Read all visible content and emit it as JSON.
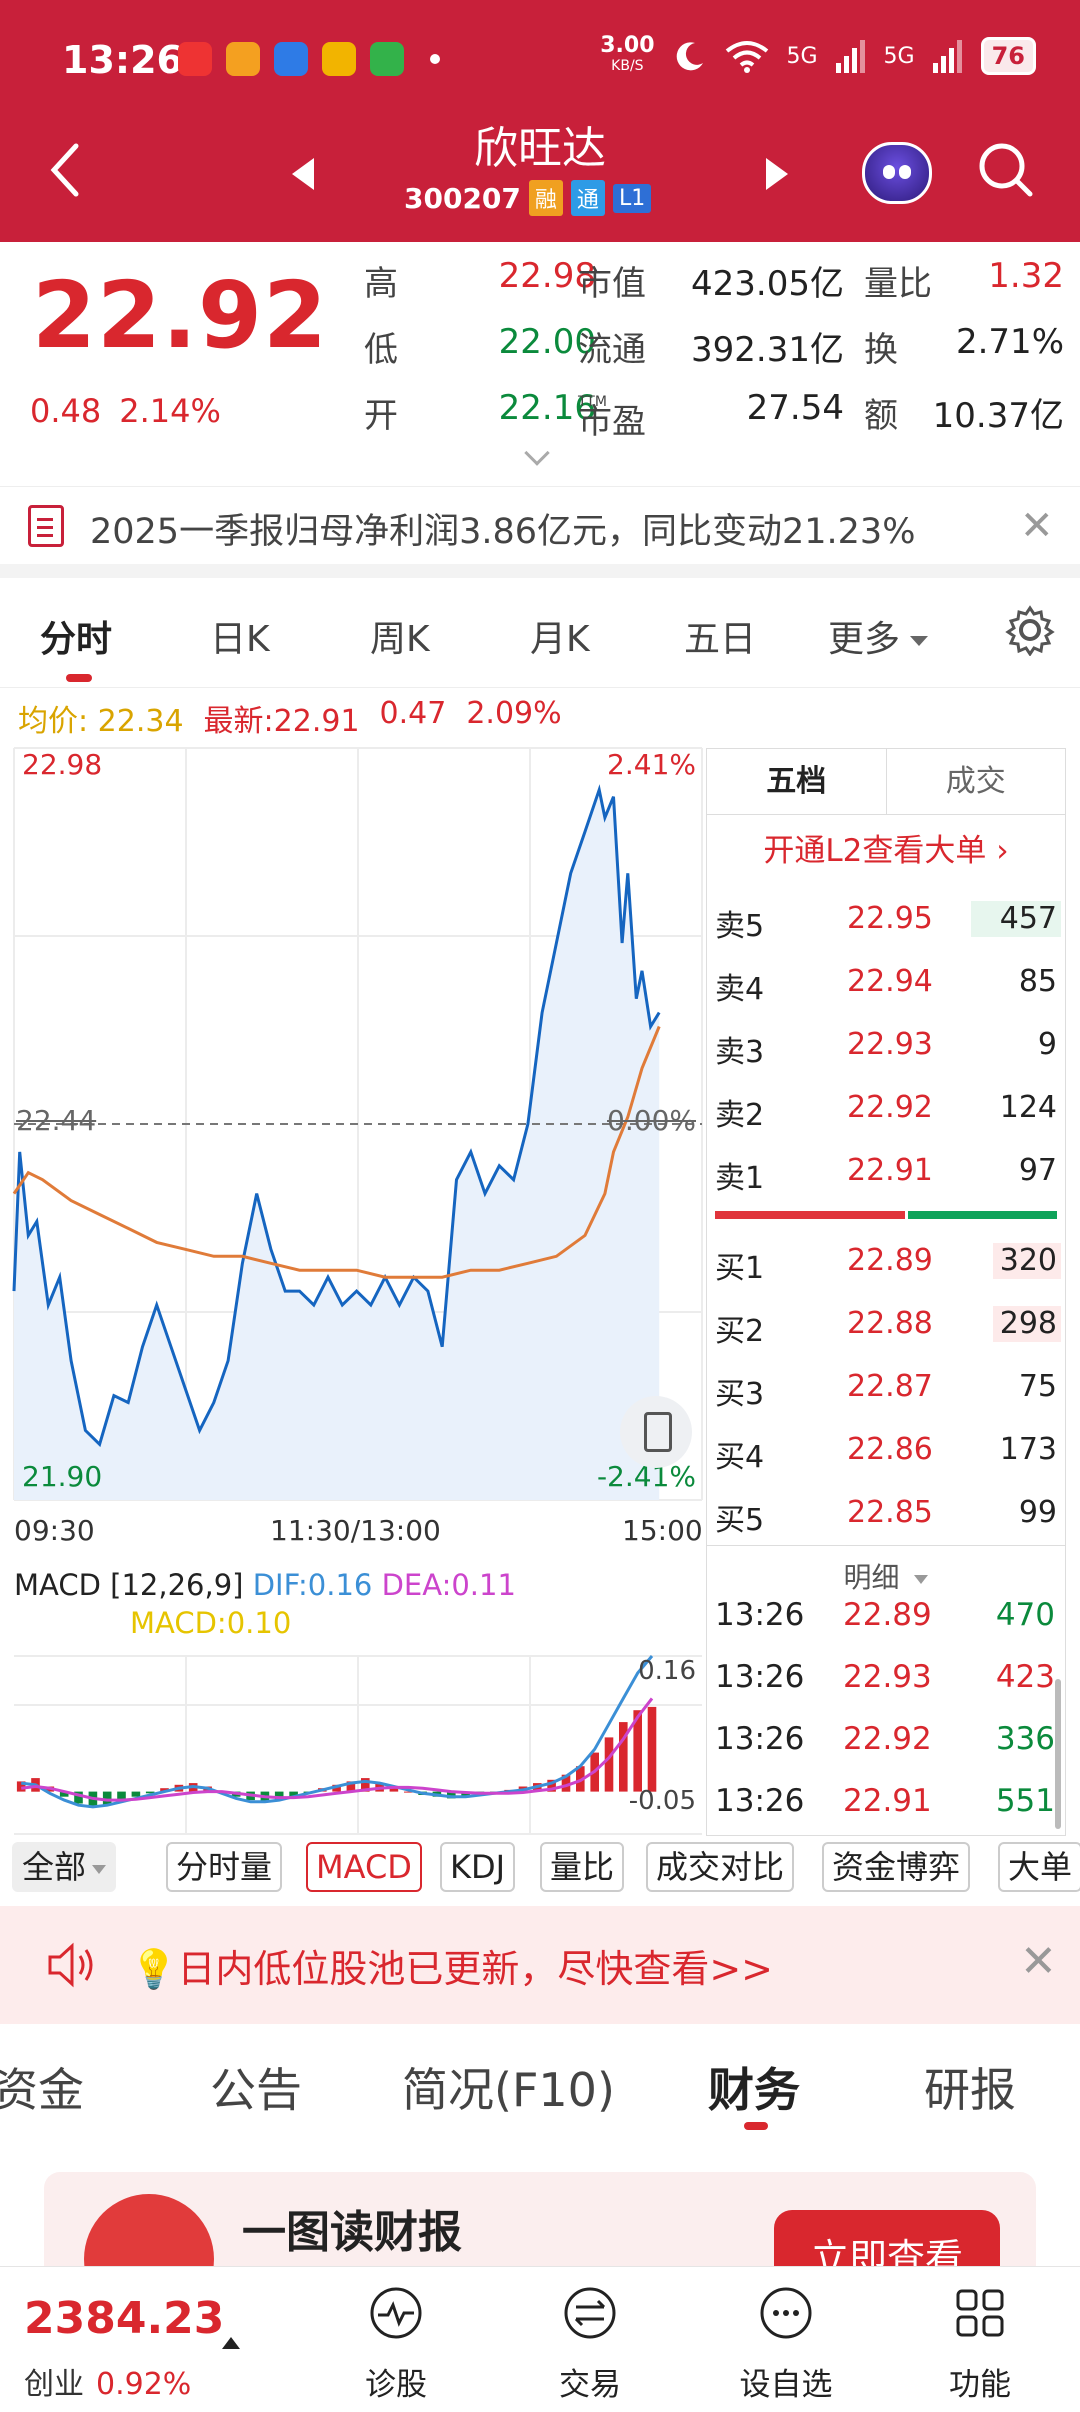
{
  "status": {
    "time": "13:26",
    "net_speed": "3.00",
    "net_unit": "KB/S",
    "signal1": "5G",
    "signal2": "5G",
    "battery": "76"
  },
  "nav": {
    "title": "欣旺达",
    "code": "300207",
    "tags": [
      "融",
      "通",
      "L1"
    ]
  },
  "quote": {
    "price": "22.92",
    "change": "0.48",
    "change_pct": "2.14%",
    "rows": [
      {
        "l1": "高",
        "v1": "22.98",
        "l2": "市值",
        "v2": "423.05亿",
        "l3": "量比",
        "v3": "1.32"
      },
      {
        "l1": "低",
        "v1": "22.00",
        "l2": "流通",
        "v2": "392.31亿",
        "l3": "换",
        "v3": "2.71%"
      },
      {
        "l1": "开",
        "v1": "22.16",
        "l2": "市盈",
        "l2_sup": "TTM",
        "v2": "27.54",
        "l3": "额",
        "v3": "10.37亿"
      }
    ]
  },
  "notice": {
    "text": "2025一季报归母净利润3.86亿元，同比变动21.23%",
    "close": "✕"
  },
  "chart_tabs": [
    "分时",
    "日K",
    "周K",
    "月K",
    "五日",
    "更多"
  ],
  "avg_line": {
    "avg_label": "均价:",
    "avg_value": "22.34",
    "latest_label": "最新:",
    "latest_value": "22.91",
    "latest_change": "0.47",
    "latest_pct": "2.09%"
  },
  "colors": {
    "header": "#c8203a",
    "up": "#d9272e",
    "down": "#0b8a3c",
    "price_line": "#1565c0",
    "avg_line": "#e07b39",
    "dif": "#3b8fd6",
    "dea": "#cc44cc",
    "macd": "#e6c400"
  },
  "chart_data": [
    {
      "type": "line",
      "title": "",
      "xlabel": "",
      "ylabel": "",
      "x_ticks": [
        "09:30",
        "11:30/13:00",
        "15:00"
      ],
      "ylim": [
        21.9,
        22.98
      ],
      "y_ticks": [
        "22.98",
        "22.44",
        "21.90"
      ],
      "y2_ticks": [
        "2.41%",
        "0.00%",
        "-2.41%"
      ],
      "reference": 22.44,
      "grid": true,
      "series": [
        {
          "x": [
            0,
            2,
            5,
            8,
            12,
            16,
            20,
            25,
            30,
            35,
            40,
            45,
            50,
            55,
            60,
            65,
            70,
            75,
            80,
            85,
            90,
            95,
            100,
            105,
            110,
            115,
            120,
            125,
            130,
            135,
            140,
            145,
            150,
            155,
            160,
            165,
            170,
            175,
            180,
            185,
            190,
            195,
            200,
            205,
            207,
            210,
            213,
            215,
            218,
            220,
            223,
            226
          ],
          "values": [
            22.2,
            22.4,
            22.28,
            22.3,
            22.18,
            22.22,
            22.1,
            22.0,
            21.98,
            22.05,
            22.04,
            22.12,
            22.18,
            22.12,
            22.06,
            22.0,
            22.04,
            22.1,
            22.24,
            22.34,
            22.26,
            22.2,
            22.2,
            22.18,
            22.22,
            22.18,
            22.2,
            22.18,
            22.22,
            22.18,
            22.22,
            22.2,
            22.12,
            22.36,
            22.4,
            22.34,
            22.38,
            22.36,
            22.44,
            22.6,
            22.7,
            22.8,
            22.86,
            22.92,
            22.88,
            22.91,
            22.7,
            22.8,
            22.62,
            22.66,
            22.58,
            22.6
          ]
        },
        {
          "x": [
            0,
            5,
            10,
            20,
            30,
            40,
            50,
            60,
            70,
            80,
            90,
            100,
            110,
            120,
            130,
            140,
            150,
            160,
            170,
            180,
            190,
            200,
            207,
            210,
            215,
            220,
            226
          ],
          "values": [
            22.34,
            22.37,
            22.36,
            22.33,
            22.31,
            22.29,
            22.27,
            22.26,
            22.25,
            22.25,
            22.24,
            22.23,
            22.23,
            22.23,
            22.22,
            22.22,
            22.22,
            22.23,
            22.23,
            22.24,
            22.25,
            22.28,
            22.34,
            22.4,
            22.45,
            22.52,
            22.58
          ]
        }
      ]
    },
    {
      "type": "bar",
      "title": "MACD",
      "params": "[12,26,9]",
      "dif": "0.16",
      "dea": "0.11",
      "macd": "0.10",
      "ylim": [
        -0.05,
        0.16
      ],
      "y_ticks": [
        "0.16",
        "-0.05"
      ],
      "series": [
        {
          "name": "MACD",
          "values": [
            0.012,
            0.016,
            0.006,
            -0.006,
            -0.014,
            -0.018,
            -0.016,
            -0.01,
            -0.006,
            -0.002,
            0.004,
            0.008,
            0.01,
            0.006,
            0.0,
            -0.006,
            -0.01,
            -0.012,
            -0.01,
            -0.006,
            -0.002,
            0.004,
            0.008,
            0.012,
            0.016,
            0.01,
            0.004,
            0.0,
            -0.004,
            -0.006,
            -0.008,
            -0.006,
            -0.004,
            -0.002,
            0.002,
            0.006,
            0.01,
            0.014,
            0.02,
            0.03,
            0.046,
            0.064,
            0.082,
            0.096,
            0.1
          ]
        },
        {
          "name": "DIF",
          "values": [
            0.01,
            0.008,
            -0.002,
            -0.01,
            -0.016,
            -0.018,
            -0.016,
            -0.012,
            -0.008,
            -0.004,
            0.0,
            0.004,
            0.006,
            0.004,
            -0.002,
            -0.008,
            -0.012,
            -0.012,
            -0.01,
            -0.006,
            -0.002,
            0.002,
            0.006,
            0.01,
            0.012,
            0.01,
            0.006,
            0.002,
            -0.002,
            -0.004,
            -0.006,
            -0.006,
            -0.004,
            -0.002,
            0.0,
            0.002,
            0.006,
            0.01,
            0.018,
            0.03,
            0.05,
            0.08,
            0.11,
            0.14,
            0.16
          ]
        },
        {
          "name": "DEA",
          "values": [
            0.004,
            0.006,
            0.004,
            0.0,
            -0.004,
            -0.008,
            -0.01,
            -0.01,
            -0.009,
            -0.007,
            -0.005,
            -0.003,
            -0.001,
            0.0,
            0.0,
            -0.002,
            -0.004,
            -0.006,
            -0.007,
            -0.007,
            -0.006,
            -0.004,
            -0.002,
            0.0,
            0.002,
            0.004,
            0.005,
            0.005,
            0.004,
            0.002,
            0.0,
            -0.001,
            -0.002,
            -0.002,
            -0.002,
            -0.001,
            0.001,
            0.003,
            0.007,
            0.013,
            0.024,
            0.04,
            0.062,
            0.088,
            0.11
          ]
        }
      ]
    }
  ],
  "order_book": {
    "tabs": [
      "五档",
      "成交"
    ],
    "l2_link": "开通L2查看大单 ›",
    "asks": [
      {
        "label": "卖5",
        "price": "22.95",
        "vol": "457",
        "hl": true
      },
      {
        "label": "卖4",
        "price": "22.94",
        "vol": "85",
        "hl": false
      },
      {
        "label": "卖3",
        "price": "22.93",
        "vol": "9",
        "hl": false
      },
      {
        "label": "卖2",
        "price": "22.92",
        "vol": "124",
        "hl": false
      },
      {
        "label": "卖1",
        "price": "22.91",
        "vol": "97",
        "hl": false
      }
    ],
    "bids": [
      {
        "label": "买1",
        "price": "22.89",
        "vol": "320",
        "hl": true
      },
      {
        "label": "买2",
        "price": "22.88",
        "vol": "298",
        "hl": true
      },
      {
        "label": "买3",
        "price": "22.87",
        "vol": "75",
        "hl": false
      },
      {
        "label": "买4",
        "price": "22.86",
        "vol": "173",
        "hl": false
      },
      {
        "label": "买5",
        "price": "22.85",
        "vol": "99",
        "hl": false
      }
    ],
    "detail_label": "明细",
    "ticks": [
      {
        "time": "13:26",
        "price": "22.89",
        "vol": "470",
        "dir": "down"
      },
      {
        "time": "13:26",
        "price": "22.93",
        "vol": "423",
        "dir": "up"
      },
      {
        "time": "13:26",
        "price": "22.92",
        "vol": "336",
        "dir": "down"
      },
      {
        "time": "13:26",
        "price": "22.91",
        "vol": "551",
        "dir": "down"
      }
    ]
  },
  "indicators": [
    "全部",
    "分时量",
    "MACD",
    "KDJ",
    "量比",
    "成交对比",
    "资金博弈",
    "大单"
  ],
  "promo": {
    "text": "💡日内低位股池已更新，尽快查看>>",
    "close": "✕"
  },
  "section_tabs": [
    "资金",
    "公告",
    "简况(F10)",
    "财务",
    "研报"
  ],
  "card": {
    "title": "一图读财报",
    "button": "立即查看"
  },
  "bottom": {
    "index_value": "2384.23",
    "index_name": "创业",
    "index_pct": "0.92%",
    "items": [
      {
        "label": "诊股",
        "icon": "diagnose-icon"
      },
      {
        "label": "交易",
        "icon": "trade-icon"
      },
      {
        "label": "设自选",
        "icon": "watchlist-icon"
      },
      {
        "label": "功能",
        "icon": "grid-icon"
      }
    ]
  }
}
